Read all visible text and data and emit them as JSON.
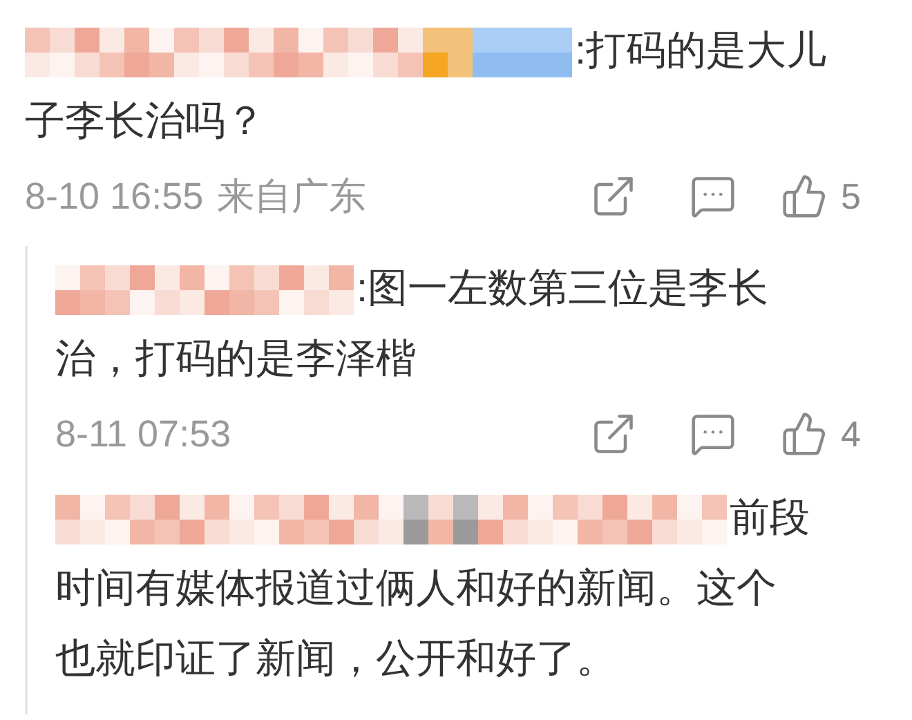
{
  "comments": [
    {
      "lines": [
        ":打码的是大儿",
        "子李长治吗？"
      ],
      "time": "8-10 16:55",
      "location": "来自广东",
      "likes": "5",
      "replies": [
        {
          "lines": [
            ":图一左数第三位是李长",
            "治，打码的是李泽楷"
          ],
          "time": "8-11 07:53",
          "likes": "4"
        },
        {
          "lines": [
            "前段",
            "时间有媒体报道过俩人和好的新闻。这个",
            "也就印证了新闻，公开和好了。"
          ]
        }
      ]
    }
  ]
}
